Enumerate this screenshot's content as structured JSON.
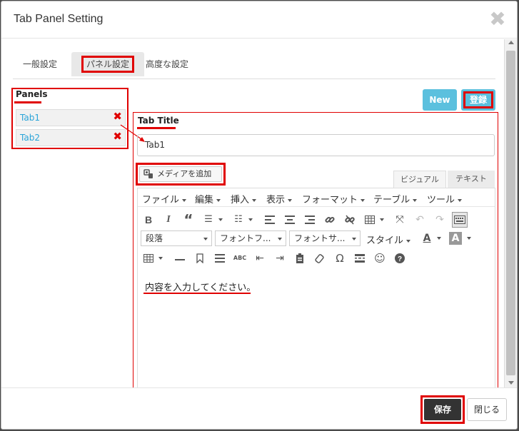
{
  "dialog": {
    "title": "Tab Panel Setting",
    "close_symbol": "✖"
  },
  "tabs": [
    {
      "label": "一般設定"
    },
    {
      "label": "パネル設定"
    },
    {
      "label": "高度な設定"
    }
  ],
  "panels": {
    "label": "Panels",
    "items": [
      {
        "label": "Tab1"
      },
      {
        "label": "Tab2"
      }
    ],
    "delete_symbol": "✖"
  },
  "actions": {
    "new_label": "New",
    "register_label": "登録"
  },
  "editor": {
    "tab_title_label": "Tab Title",
    "tab_title_value": "Tab1",
    "add_media_label": "メディアを追加",
    "mode_visual": "ビジュアル",
    "mode_text": "テキスト",
    "menus": [
      "ファイル",
      "編集",
      "挿入",
      "表示",
      "フォーマット",
      "テーブル",
      "ツール"
    ],
    "format_select": "段落",
    "font_family_select": "フォントフ...",
    "font_size_select": "フォントサ...",
    "style_menu": "スタイル",
    "content": "内容を入力してください。"
  },
  "footer": {
    "save_label": "保存",
    "close_label": "閉じる"
  },
  "colors": {
    "accent_info": "#5bc0de",
    "highlight": "#e00000",
    "link": "#2aa4d8",
    "dark_button": "#333333"
  }
}
